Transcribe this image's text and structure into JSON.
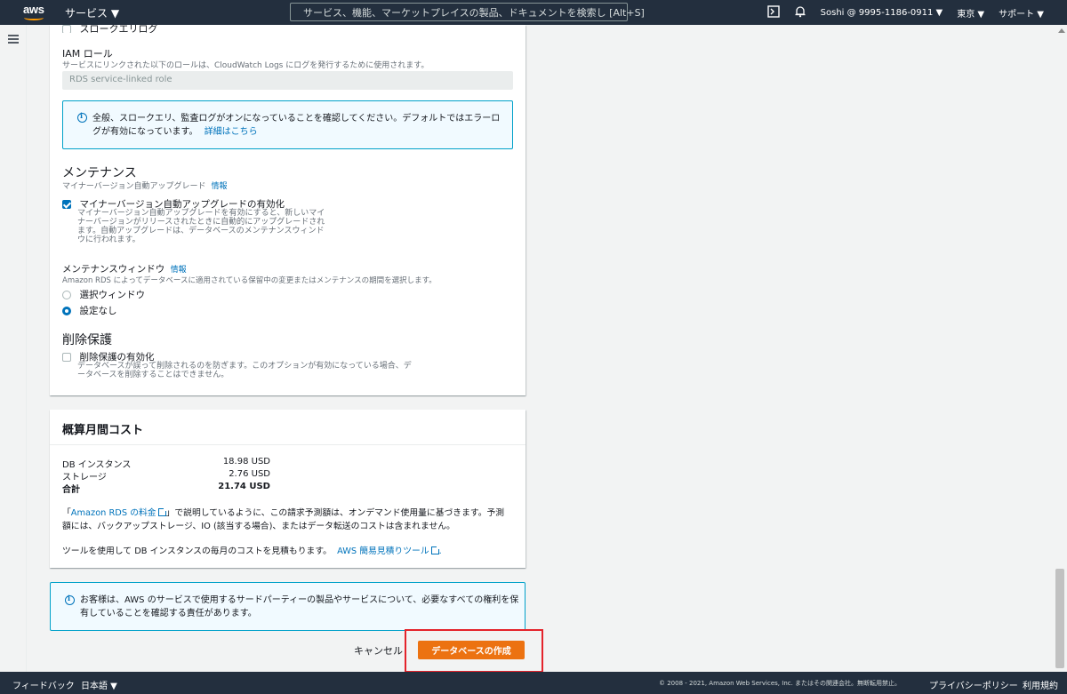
{
  "nav": {
    "logo": "aws",
    "services": "サービス ▼",
    "search_placeholder": "サービス、機能、マーケットプレイスの製品、ドキュメントを検索し [Alt+S]",
    "account": "Soshi @ 9995-1186-0911 ▼",
    "region": "東京 ▼",
    "support": "サポート ▼",
    "icons": [
      "cloudshell-icon",
      "bell-icon"
    ]
  },
  "logs": {
    "slow_query_label": "スロークエリログ",
    "iam_role_title": "IAM ロール",
    "iam_role_desc": "サービスにリンクされた以下のロールは、CloudWatch Logs にログを発行するために使用されます。",
    "iam_role_value": "RDS service-linked role",
    "info_text_1": "全般、スロークエリ、監査ログがオンになっていることを確認してください。デフォルトではエラーロ",
    "info_text_2": "グが有効になっています。",
    "info_link": "詳細はこちら"
  },
  "maintenance": {
    "title": "メンテナンス",
    "subtitle": "マイナーバージョン自動アップグレード",
    "info_link": "情報",
    "auto_upgrade_label": "マイナーバージョン自動アップグレードの有効化",
    "auto_upgrade_checked": true,
    "auto_upgrade_desc_lines": [
      "マイナーバージョン自動アップグレードを有効にすると、新しいマイ",
      "ナーバージョンがリリースされたときに自動的にアップグレードされ",
      "ます。自動アップグレードは、データベースのメンテナンスウィンド",
      "ウに行われます。"
    ],
    "window_title": "メンテナンスウィンドウ",
    "window_info_link": "情報",
    "window_desc": "Amazon RDS によってデータベースに適用されている保留中の変更またはメンテナンスの期間を選択します。",
    "options": [
      {
        "label": "選択ウィンドウ",
        "selected": false
      },
      {
        "label": "設定なし",
        "selected": true
      }
    ]
  },
  "deletion": {
    "title": "削除保護",
    "label": "削除保護の有効化",
    "checked": false,
    "desc_lines": [
      "データベースが誤って削除されるのを防ぎます。このオプションが有効になっている場合、デ",
      "ータベースを削除することはできません。"
    ]
  },
  "cost": {
    "title": "概算月間コスト",
    "rows": [
      {
        "label": "DB インスタンス",
        "value": "18.98 USD"
      },
      {
        "label": "ストレージ",
        "value": "2.76 USD"
      },
      {
        "label": "合計",
        "value": "21.74 USD"
      }
    ],
    "note_prefix": "「",
    "note_link": "Amazon RDS の料金",
    "note_text_1": "」で説明しているように、この請求予測額は、オンデマンド使用量に基づきます。予測",
    "note_text_2": "額には、バックアップストレージ、IO (該当する場合)、またはデータ転送のコストは含まれません。",
    "tool_text": "ツールを使用して DB インスタンスの毎月のコストを見積もります。",
    "tool_link": "AWS 簡易見積りツール",
    "tool_suffix": "."
  },
  "notice": {
    "line_1": "お客様は、AWS のサービスで使用するサードパーティーの製品やサービスについて、必要なすべての権利を保",
    "line_2": "有していることを確認する責任があります。"
  },
  "actions": {
    "cancel": "キャンセル",
    "create": "データベースの作成"
  },
  "footer": {
    "feedback": "フィードバック",
    "language": "日本語 ▼",
    "copyright": "© 2008 - 2021, Amazon Web Services, Inc. またはその関連会社。無断転用禁止。",
    "privacy": "プライバシーポリシー",
    "terms": "利用規約"
  },
  "colors": {
    "nav_bg": "#232f3e",
    "primary_button": "#ec7211",
    "link": "#0073bb",
    "highlight_box": "#e4232b",
    "info_border": "#00a1c9"
  }
}
